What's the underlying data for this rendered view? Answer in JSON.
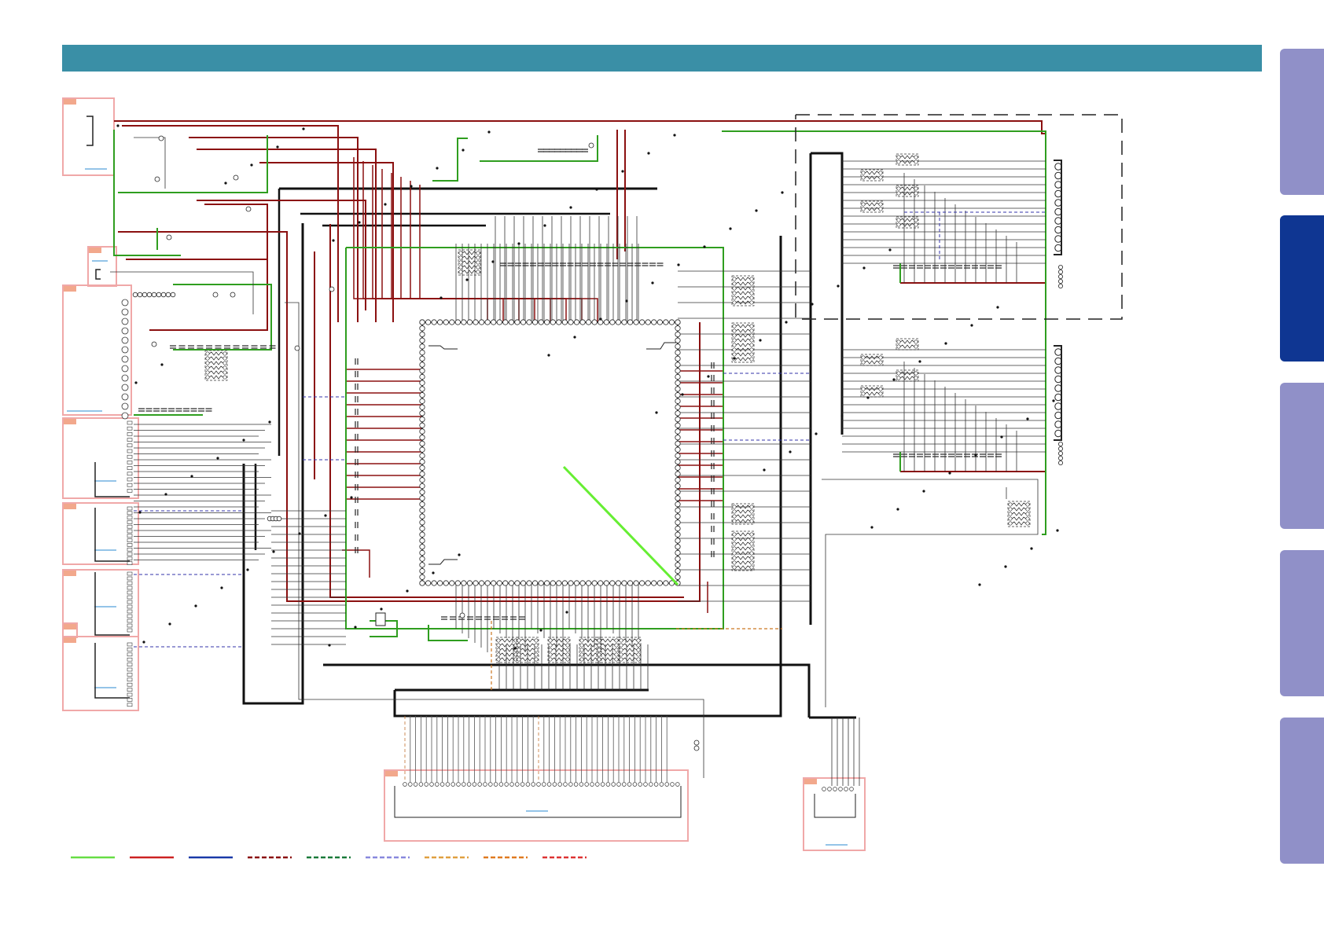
{
  "header": {
    "color": "#3a8fa6"
  },
  "side_tabs": [
    {
      "name": "tab-1",
      "color": "#9090c8",
      "active": false
    },
    {
      "name": "tab-2",
      "color": "#0f3692",
      "active": true
    },
    {
      "name": "tab-3",
      "color": "#9090c8",
      "active": false
    },
    {
      "name": "tab-4",
      "color": "#9090c8",
      "active": false
    },
    {
      "name": "tab-5",
      "color": "#9090c8",
      "active": false
    }
  ],
  "colors": {
    "connector_box": "#f0a8a8",
    "connector_tag": "#f2a88c",
    "wire_black": "#222222",
    "wire_red": "#8b1010",
    "wire_green": "#2f9e1f",
    "wire_bright_green": "#66ee33",
    "wire_blue_dashed": "#3333aa",
    "wire_orange_dashed": "#cc7722",
    "link_blue": "#2a8ad0"
  },
  "legend": [
    {
      "color": "#66dd44",
      "style": "solid"
    },
    {
      "color": "#cc2222",
      "style": "solid"
    },
    {
      "color": "#1a3aa8",
      "style": "solid"
    },
    {
      "color": "#8b1010",
      "style": "dashed"
    },
    {
      "color": "#1a7a3a",
      "style": "dashed"
    },
    {
      "color": "#8888dd",
      "style": "dashed"
    },
    {
      "color": "#e0a040",
      "style": "dashed"
    },
    {
      "color": "#e07a20",
      "style": "dashed"
    },
    {
      "color": "#dd3333",
      "style": "dashed"
    }
  ]
}
